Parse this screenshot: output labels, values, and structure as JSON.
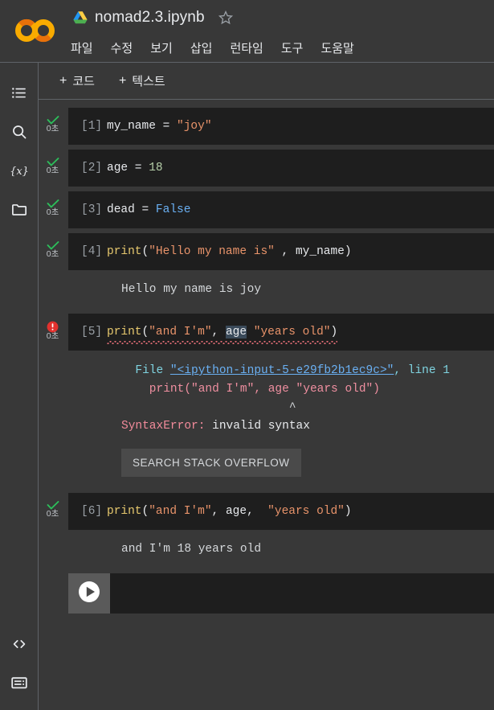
{
  "app": {
    "brand": "Colab",
    "logo_colors": {
      "ring_outer": "#F9AB00",
      "ring_inner": "#E8710A"
    }
  },
  "header": {
    "drive_icon": "google-drive-icon",
    "doc_title": "nomad2.3.ipynb",
    "star_icon": "star-outline-icon",
    "menu": [
      {
        "label": "파일",
        "name": "menu-file"
      },
      {
        "label": "수정",
        "name": "menu-edit"
      },
      {
        "label": "보기",
        "name": "menu-view"
      },
      {
        "label": "삽입",
        "name": "menu-insert"
      },
      {
        "label": "런타임",
        "name": "menu-runtime"
      },
      {
        "label": "도구",
        "name": "menu-tools"
      },
      {
        "label": "도움말",
        "name": "menu-help"
      }
    ]
  },
  "sidebar": {
    "top_items": [
      {
        "icon": "table-of-contents-icon",
        "name": "sidebar-toc"
      },
      {
        "icon": "search-icon",
        "name": "sidebar-search"
      },
      {
        "icon": "variables-icon",
        "name": "sidebar-variables"
      },
      {
        "icon": "folder-icon",
        "name": "sidebar-files"
      }
    ],
    "bottom_items": [
      {
        "icon": "code-snippets-icon",
        "name": "sidebar-code-snippets"
      },
      {
        "icon": "terminal-icon",
        "name": "sidebar-terminal"
      }
    ]
  },
  "toolbar": {
    "add_code_label": "코드",
    "add_text_label": "텍스트",
    "plus": "+"
  },
  "cells": [
    {
      "index": "[1]",
      "status": "success",
      "exec_time": "0초",
      "code_plain": "my_name = \"joy\"",
      "output": null
    },
    {
      "index": "[2]",
      "status": "success",
      "exec_time": "0초",
      "code_plain": "age = 18",
      "output": null
    },
    {
      "index": "[3]",
      "status": "success",
      "exec_time": "0초",
      "code_plain": "dead = False",
      "output": null
    },
    {
      "index": "[4]",
      "status": "success",
      "exec_time": "0초",
      "code_plain": "print(\"Hello my name is\" , my_name)",
      "output": "Hello my name is joy"
    },
    {
      "index": "[5]",
      "status": "error",
      "exec_time": "0초",
      "code_plain": "print(\"and I'm\", age \"years old\")",
      "traceback": {
        "file_prefix": "  File ",
        "file_link": "\"<ipython-input-5-e29fb2b1ec9c>\"",
        "file_suffix": ", line 1",
        "source_line": "    print(\"and I'm\", age \"years old\")",
        "caret_line": "                        ^",
        "error_name": "SyntaxError:",
        "error_message": " invalid syntax",
        "search_button": "SEARCH STACK OVERFLOW"
      }
    },
    {
      "index": "[6]",
      "status": "success",
      "exec_time": "0초",
      "code_plain": "print(\"and I'm\", age,  \"years old\")",
      "output": "and I'm 18 years old"
    }
  ],
  "empty_cell": {
    "run_icon": "play-circle-icon"
  },
  "colors": {
    "bg": "#383838",
    "code_bg": "#1e1e1e",
    "string": "#e8936a",
    "function": "#e6c86e",
    "keyword": "#6ab0f3",
    "number": "#b5cea8",
    "error_red": "#f28b9b",
    "success_green": "#2cbe5a",
    "link_blue": "#6ab0f3"
  }
}
